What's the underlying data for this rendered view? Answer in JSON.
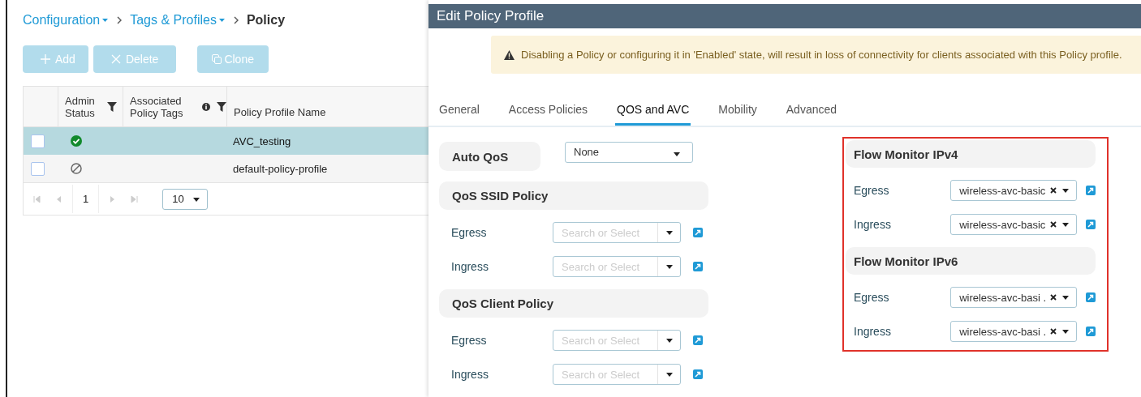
{
  "breadcrumb": [
    {
      "label": "Configuration",
      "kind": "menu"
    },
    {
      "label": "Tags & Profiles",
      "kind": "menu"
    },
    {
      "label": "Policy",
      "kind": "current"
    }
  ],
  "toolbar": [
    {
      "label": "Add",
      "kind": "add",
      "disabled": true
    },
    {
      "label": "Delete",
      "kind": "delete",
      "disabled": true
    },
    {
      "label": "Clone",
      "kind": "clone",
      "disabled": true
    }
  ],
  "table": {
    "columns": [
      {
        "label": "Admin Status",
        "filter": true,
        "info": false
      },
      {
        "label": "Associated Policy Tags",
        "filter": true,
        "info": true
      },
      {
        "label": "Policy Profile Name",
        "filter": false,
        "info": false
      }
    ],
    "rows": [
      {
        "selected": true,
        "checked": false,
        "admin_enabled": true,
        "name": "AVC_testing"
      },
      {
        "selected": false,
        "checked": false,
        "admin_enabled": false,
        "name": "default-policy-profile"
      }
    ],
    "pager": {
      "page": "1",
      "page_size": "10"
    }
  },
  "dialog": {
    "title": "Edit Policy Profile",
    "warning": "Disabling a Policy or configuring it in 'Enabled' state, will result in loss of connectivity for clients associated with this Policy profile.",
    "tabs": [
      {
        "label": "General",
        "selected": false
      },
      {
        "label": "Access Policies",
        "selected": false
      },
      {
        "label": "QOS and AVC",
        "selected": true
      },
      {
        "label": "Mobility",
        "selected": false
      },
      {
        "label": "Advanced",
        "selected": false
      }
    ],
    "left_sections": [
      {
        "kind": "inline",
        "title": "Auto QoS",
        "value": "None"
      },
      {
        "kind": "group",
        "title": "QoS SSID Policy",
        "rows": [
          {
            "label": "Egress",
            "placeholder": "Search or Select"
          },
          {
            "label": "Ingress",
            "placeholder": "Search or Select"
          }
        ]
      },
      {
        "kind": "group",
        "title": "QoS Client Policy",
        "rows": [
          {
            "label": "Egress",
            "placeholder": "Search or Select"
          },
          {
            "label": "Ingress",
            "placeholder": "Search or Select"
          }
        ]
      }
    ],
    "right_panel": {
      "highlighted": true,
      "sections": [
        {
          "kind": "group",
          "title": "Flow Monitor IPv4",
          "rows": [
            {
              "label": "Egress",
              "value": "wireless-avc-basic"
            },
            {
              "label": "Ingress",
              "value": "wireless-avc-basic"
            }
          ]
        },
        {
          "kind": "group",
          "title": "Flow Monitor IPv6",
          "rows": [
            {
              "label": "Egress",
              "value": "wireless-avc-basi ."
            },
            {
              "label": "Ingress",
              "value": "wireless-avc-basi ."
            }
          ]
        }
      ]
    }
  }
}
